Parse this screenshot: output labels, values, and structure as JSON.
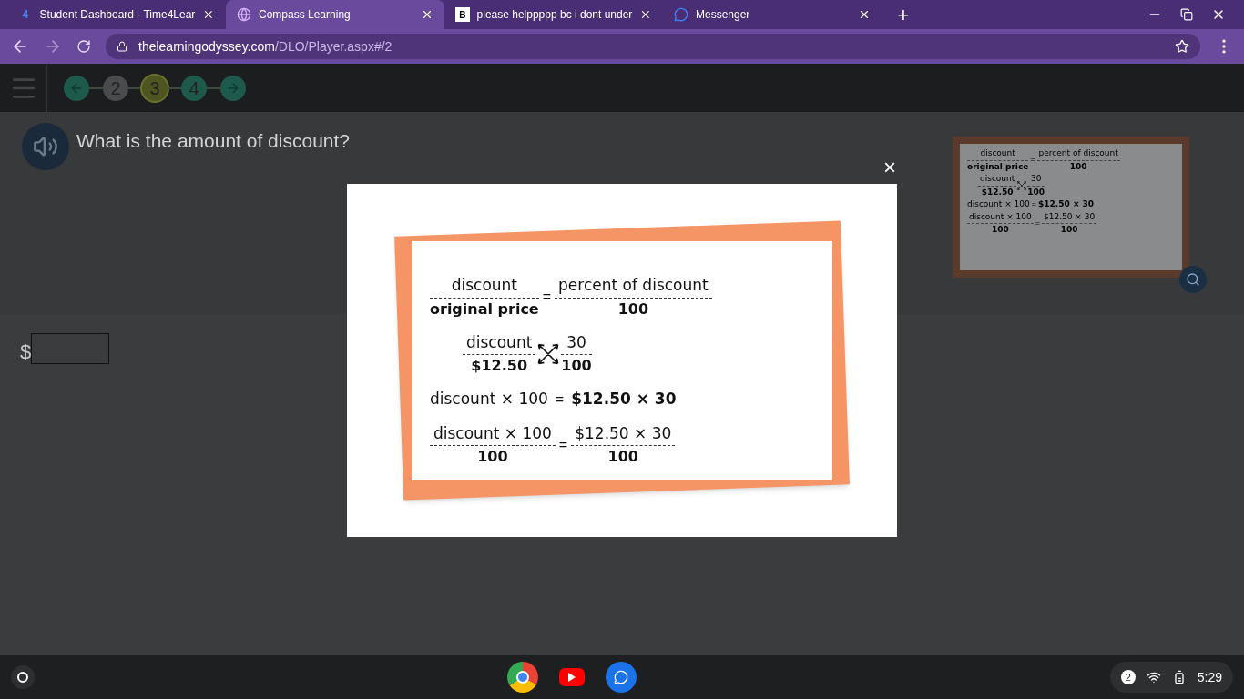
{
  "browser": {
    "tabs": [
      {
        "label": "Student Dashboard - Time4Lear",
        "selected": false,
        "kind": "number"
      },
      {
        "label": "Compass Learning",
        "selected": true,
        "kind": "globe"
      },
      {
        "label": "please helppppp bc i dont under",
        "selected": false,
        "kind": "letter"
      },
      {
        "label": "Messenger",
        "selected": false,
        "kind": "chat"
      }
    ],
    "tab_icon_text": {
      "number": "4",
      "letter": "B"
    },
    "new_tab": "+",
    "address": {
      "domain": "thelearningodyssey.com",
      "path": "/DLO/Player.aspx#/2"
    }
  },
  "toolbar": {
    "steps": [
      {
        "kind": "back",
        "color": "#1d5a4c",
        "selected": false
      },
      {
        "kind": "number",
        "label": "2",
        "color": "#4a4b4c",
        "selected": false
      },
      {
        "kind": "number",
        "label": "3",
        "color": "#4f5521",
        "selected": true
      },
      {
        "kind": "number",
        "label": "4",
        "color": "#1d5a4c",
        "selected": false
      },
      {
        "kind": "next",
        "color": "#1d5a4c",
        "selected": false
      }
    ]
  },
  "question": {
    "text": "What is the amount of discount?"
  },
  "answer": {
    "prefix": "$"
  },
  "equations": [
    {
      "kind": "equation",
      "left": {
        "num": "discount",
        "den": "original price"
      },
      "operator": "=",
      "right": {
        "num": "percent of discount",
        "den": "100"
      }
    },
    {
      "kind": "cross",
      "left": {
        "num": "discount",
        "den": "$12.50"
      },
      "right": {
        "num": "30",
        "den": "100"
      }
    },
    {
      "kind": "line",
      "left": "discount × 100",
      "operator": "=",
      "right": "$12.50 × 30"
    },
    {
      "kind": "equation",
      "left": {
        "num": "discount × 100",
        "den": "100"
      },
      "operator": "=",
      "right": {
        "num": "$12.50 × 30",
        "den": "100"
      }
    }
  ],
  "thumbnail_equations": [
    {
      "kind": "equation",
      "left": {
        "num": "discount",
        "den": "original price"
      },
      "operator": "=",
      "right": {
        "num": "percent of discount",
        "den": "100"
      }
    },
    {
      "kind": "cross",
      "left": {
        "num": "discount",
        "den": "$12.50"
      },
      "right": {
        "num": "30",
        "den": "100"
      }
    },
    {
      "kind": "line",
      "left": "discount × 100",
      "operator": "=",
      "right": "$12.50 × 30"
    },
    {
      "kind": "equation",
      "left": {
        "num": "discount × 100",
        "den": "100"
      },
      "operator": "=",
      "right": {
        "num": "$12.50 × 30",
        "den": "100"
      }
    }
  ],
  "modal": {
    "close": "×"
  },
  "taskbar": {
    "notifications": "2",
    "time": "5:29"
  }
}
